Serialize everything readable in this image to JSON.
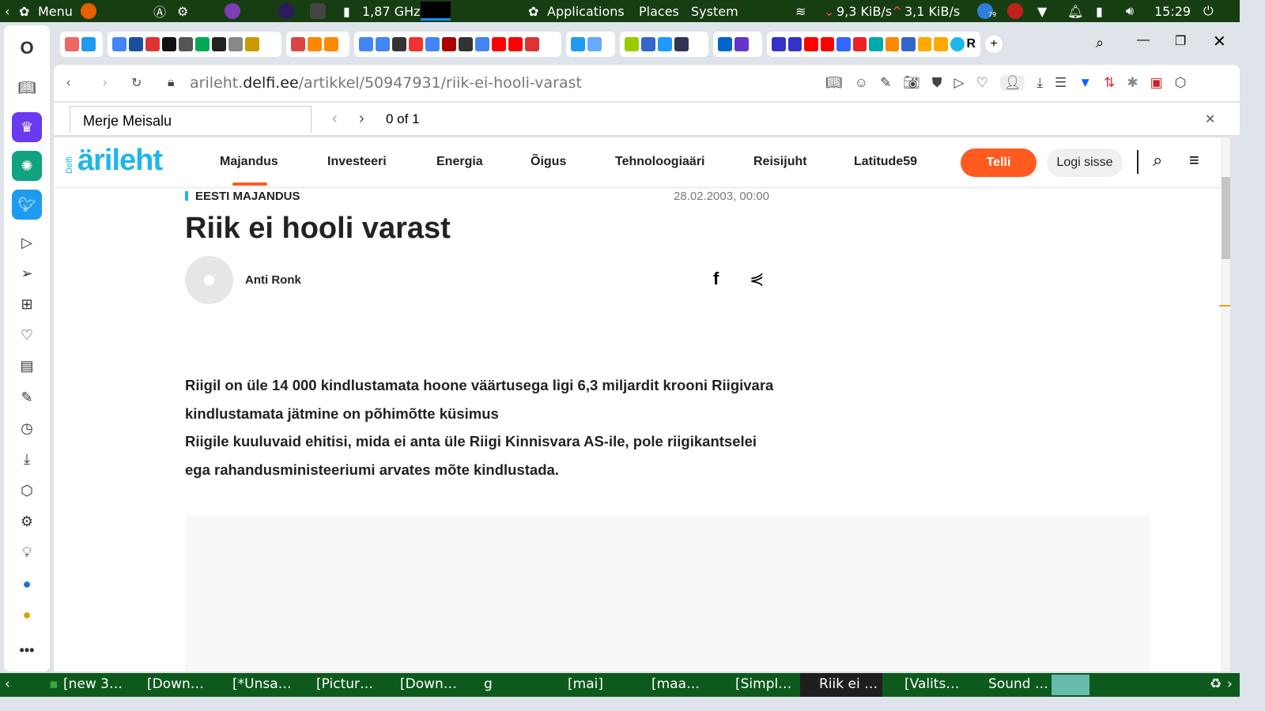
{
  "topbar": {
    "menu": "Menu",
    "cpu": "1,87 GHz",
    "applications": "Applications",
    "places": "Places",
    "system": "System",
    "net_down": "9,3 KiB/s",
    "net_up": "3,1 KiB/s",
    "time": "15:29",
    "notif_badge": "79"
  },
  "browser": {
    "url_host_pre": "arileht.",
    "url_host": "delfi.ee",
    "url_path": "/artikkel/50947931/riik-ei-hooli-varast",
    "find_value": "Merje Meisalu",
    "find_count": "0 of 1",
    "active_tab_letter": "R"
  },
  "site": {
    "logo_small": "Delfi",
    "logo": "ärileht",
    "nav": [
      "Majandus",
      "Investeeri",
      "Energia",
      "Õigus",
      "Tehnoloogiaäri",
      "Reisijuht",
      "Latitude59"
    ],
    "subscribe": "Telli",
    "login": "Logi sisse"
  },
  "article": {
    "category": "EESTI MAJANDUS",
    "date": "28.02.2003, 00:00",
    "title": "Riik ei hooli varast",
    "author": "Anti Ronk",
    "lead": [
      "Riigil on üle 14 000 kindlustamata hoone väärtusega ligi 6,3 miljardit krooni Riigivara",
      "kindlustamata jätmine on põhimõtte küsimus",
      "Riigile kuuluvaid ehitisi, mida ei anta üle Riigi Kinnisvara AS-ile, pole riigikantselei",
      "ega rahandusministeeriumi arvates mõte kindlustada."
    ]
  },
  "taskbar": [
    "[new 3…",
    "[Down…",
    "[*Unsa…",
    "[Pictur…",
    "[Down…",
    "g",
    "[mai]",
    "[maa…",
    "[Simpl…",
    "Riik ei …",
    "[Valits…",
    "Sound …"
  ],
  "colors": {
    "accent": "#ff5a1f",
    "logo": "#1fb6ea",
    "panel": "#173d12",
    "taskbar": "#0e5a1d"
  }
}
